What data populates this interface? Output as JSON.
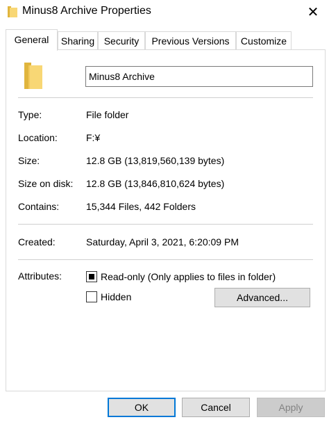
{
  "window": {
    "title": "Minus8 Archive Properties",
    "close_glyph": "✕"
  },
  "tabs": [
    {
      "label": "General",
      "active": true
    },
    {
      "label": "Sharing",
      "active": false
    },
    {
      "label": "Security",
      "active": false
    },
    {
      "label": "Previous Versions",
      "active": false
    },
    {
      "label": "Customize",
      "active": false
    }
  ],
  "general": {
    "name_value": "Minus8 Archive",
    "type_label": "Type:",
    "type_value": "File folder",
    "location_label": "Location:",
    "location_value": "F:¥",
    "size_label": "Size:",
    "size_value": "12.8 GB (13,819,560,139 bytes)",
    "size_on_disk_label": "Size on disk:",
    "size_on_disk_value": "12.8 GB (13,846,810,624 bytes)",
    "contains_label": "Contains:",
    "contains_value": "15,344 Files, 442 Folders",
    "created_label": "Created:",
    "created_value": "Saturday, April 3, 2021, 6:20:09 PM",
    "attributes_label": "Attributes:",
    "readonly_label": "Read-only (Only applies to files in folder)",
    "readonly_state": "indeterminate",
    "hidden_label": "Hidden",
    "hidden_checked": false,
    "advanced_label": "Advanced..."
  },
  "buttons": {
    "ok": "OK",
    "cancel": "Cancel",
    "apply": "Apply"
  },
  "colors": {
    "folder_yellow": "#f8d775",
    "folder_dark": "#e0b53d",
    "focus_blue": "#0078d7"
  }
}
